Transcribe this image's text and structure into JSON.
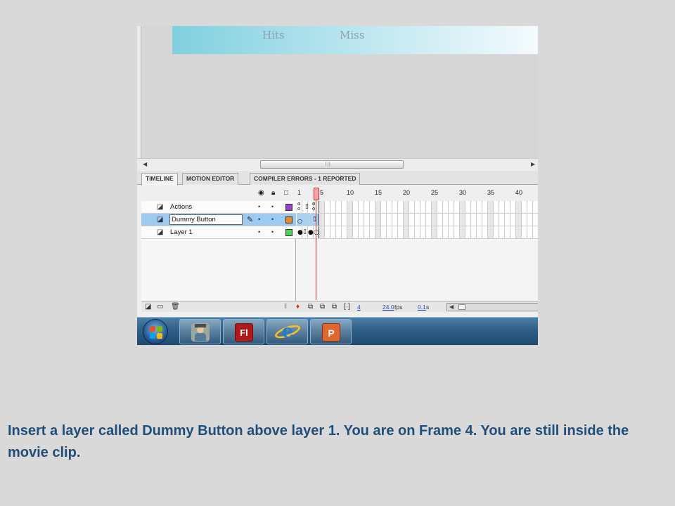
{
  "stage": {
    "banner_hits": "Hits",
    "banner_miss": "Miss"
  },
  "timeline": {
    "tabs": [
      {
        "label": "TIMELINE",
        "active": true
      },
      {
        "label": "MOTION EDITOR",
        "active": false
      },
      {
        "label": "COMPILER ERRORS - 1 REPORTED",
        "active": false
      }
    ],
    "header_icons": [
      "eye-icon",
      "lock-icon",
      "outline-icon"
    ],
    "ruler": [
      "1",
      "5",
      "10",
      "15",
      "20",
      "25",
      "30",
      "35",
      "40"
    ],
    "current_frame": 4,
    "layers": [
      {
        "name": "Actions",
        "color": "#9a3fd0",
        "selected": false,
        "editing": false
      },
      {
        "name": "Dummy Button",
        "color": "#f08a1e",
        "selected": true,
        "editing": true
      },
      {
        "name": "Layer 1",
        "color": "#3fdc4a",
        "selected": false,
        "editing": false
      }
    ],
    "bottom": {
      "frame": "4",
      "fps_value": "24.0",
      "fps_unit": "fps",
      "time_value": "0.1",
      "time_unit": "s"
    }
  },
  "taskbar": {
    "apps": [
      "user-app",
      "flash",
      "internet-explorer",
      "powerpoint"
    ],
    "flash_label": "Fl",
    "ppt_label": "P"
  },
  "caption": "Insert a layer called Dummy Button above layer 1. You are on Frame 4. You are still inside the movie clip."
}
